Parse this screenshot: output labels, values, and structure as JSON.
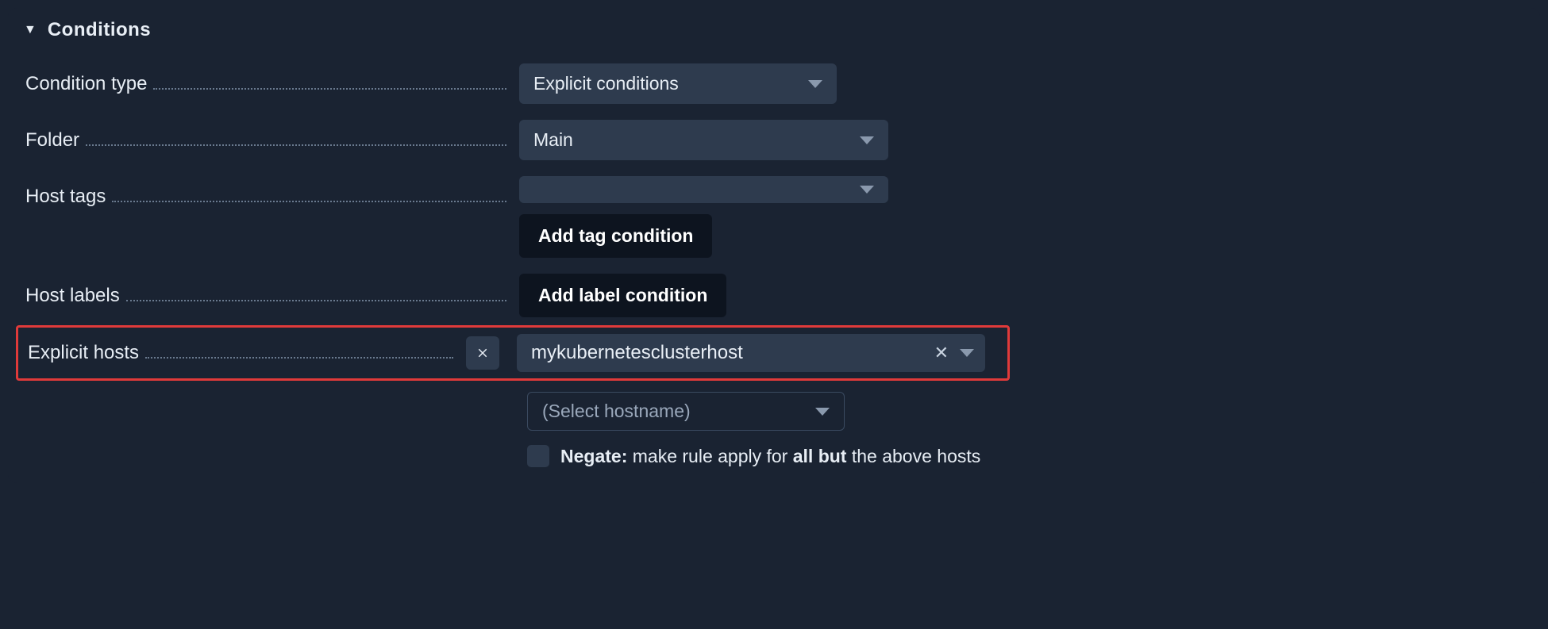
{
  "section": {
    "title": "Conditions"
  },
  "rows": {
    "condition_type": {
      "label": "Condition type",
      "value": "Explicit conditions"
    },
    "folder": {
      "label": "Folder",
      "value": "Main"
    },
    "host_tags": {
      "label": "Host tags",
      "value": "",
      "add_button": "Add tag condition"
    },
    "host_labels": {
      "label": "Host labels",
      "add_button": "Add label condition"
    },
    "explicit_hosts": {
      "label": "Explicit hosts",
      "selected_host": "mykubernetesclusterhost",
      "placeholder": "(Select hostname)",
      "negate_label": "Negate:",
      "negate_desc_prefix": " make rule apply for ",
      "negate_desc_bold": "all but",
      "negate_desc_suffix": " the above hosts"
    }
  }
}
